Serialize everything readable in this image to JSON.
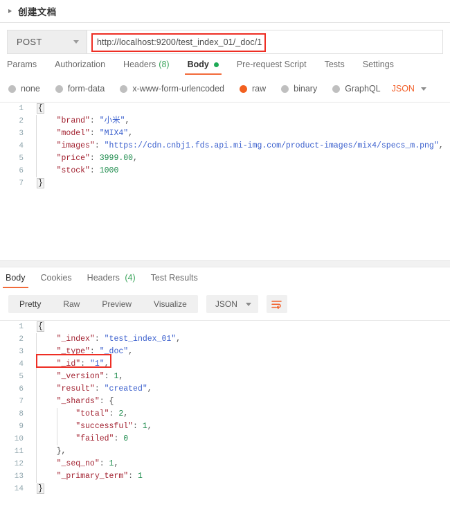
{
  "doc_heading": {
    "title": "创建文档",
    "expander_icon": "triangle-right-icon"
  },
  "url_bar": {
    "method": "POST",
    "method_caret_icon": "chevron-down-icon",
    "url": "http://localhost:9200/test_index_01/_doc/1",
    "highlight_color": "#ee2e24"
  },
  "request_tabs": [
    {
      "label": "Params",
      "active": false
    },
    {
      "label": "Authorization",
      "active": false
    },
    {
      "label": "Headers",
      "count": "(8)",
      "active": false
    },
    {
      "label": "Body",
      "active": true,
      "dot": true
    },
    {
      "label": "Pre-request Script",
      "active": false
    },
    {
      "label": "Tests",
      "active": false
    },
    {
      "label": "Settings",
      "active": false
    }
  ],
  "body_types": [
    {
      "label": "none",
      "selected": false
    },
    {
      "label": "form-data",
      "selected": false
    },
    {
      "label": "x-www-form-urlencoded",
      "selected": false
    },
    {
      "label": "raw",
      "selected": true
    },
    {
      "label": "binary",
      "selected": false
    },
    {
      "label": "GraphQL",
      "selected": false
    }
  ],
  "body_format": {
    "value": "JSON",
    "caret_icon": "chevron-down-icon",
    "color": "#f2602a"
  },
  "request_body_lines": [
    {
      "n": "1",
      "segments": [
        {
          "t": "{",
          "c": "brace-box"
        }
      ]
    },
    {
      "n": "2",
      "segments": [
        {
          "t": "    ",
          "c": "punc"
        },
        {
          "t": "\"brand\"",
          "c": "key"
        },
        {
          "t": ": ",
          "c": "punc"
        },
        {
          "t": "\"小米\"",
          "c": "str"
        },
        {
          "t": ",",
          "c": "punc"
        }
      ]
    },
    {
      "n": "3",
      "segments": [
        {
          "t": "    ",
          "c": "punc"
        },
        {
          "t": "\"model\"",
          "c": "key"
        },
        {
          "t": ": ",
          "c": "punc"
        },
        {
          "t": "\"MIX4\"",
          "c": "str"
        },
        {
          "t": ",",
          "c": "punc"
        }
      ]
    },
    {
      "n": "4",
      "segments": [
        {
          "t": "    ",
          "c": "punc"
        },
        {
          "t": "\"images\"",
          "c": "key"
        },
        {
          "t": ": ",
          "c": "punc"
        },
        {
          "t": "\"https://cdn.cnbj1.fds.api.mi-img.com/product-images/mix4/specs_m.png\"",
          "c": "str"
        },
        {
          "t": ",",
          "c": "punc"
        }
      ]
    },
    {
      "n": "5",
      "segments": [
        {
          "t": "    ",
          "c": "punc"
        },
        {
          "t": "\"price\"",
          "c": "key"
        },
        {
          "t": ": ",
          "c": "punc"
        },
        {
          "t": "3999.00",
          "c": "num"
        },
        {
          "t": ",",
          "c": "punc"
        }
      ]
    },
    {
      "n": "6",
      "segments": [
        {
          "t": "    ",
          "c": "punc"
        },
        {
          "t": "\"stock\"",
          "c": "key"
        },
        {
          "t": ": ",
          "c": "punc"
        },
        {
          "t": "1000",
          "c": "num"
        }
      ]
    },
    {
      "n": "7",
      "segments": [
        {
          "t": "}",
          "c": "brace-box"
        }
      ]
    }
  ],
  "response_tabs": [
    {
      "label": "Body",
      "active": true
    },
    {
      "label": "Cookies",
      "active": false
    },
    {
      "label": "Headers",
      "count": "(4)",
      "active": false
    },
    {
      "label": "Test Results",
      "active": false
    }
  ],
  "response_view_modes": [
    {
      "label": "Pretty",
      "active": true
    },
    {
      "label": "Raw",
      "active": false
    },
    {
      "label": "Preview",
      "active": false
    },
    {
      "label": "Visualize",
      "active": false
    }
  ],
  "response_format": {
    "value": "JSON",
    "caret_icon": "chevron-down-icon"
  },
  "wrap_button": {
    "icon": "word-wrap-icon",
    "color": "#f2602a"
  },
  "response_body_lines": [
    {
      "n": "1",
      "segments": [
        {
          "t": "{",
          "c": "brace-box"
        }
      ]
    },
    {
      "n": "2",
      "segments": [
        {
          "t": "    ",
          "c": "punc"
        },
        {
          "t": "\"_index\"",
          "c": "key"
        },
        {
          "t": ": ",
          "c": "punc"
        },
        {
          "t": "\"test_index_01\"",
          "c": "str"
        },
        {
          "t": ",",
          "c": "punc"
        }
      ]
    },
    {
      "n": "3",
      "segments": [
        {
          "t": "    ",
          "c": "punc"
        },
        {
          "t": "\"_type\"",
          "c": "key"
        },
        {
          "t": ": ",
          "c": "punc"
        },
        {
          "t": "\"_doc\"",
          "c": "str"
        },
        {
          "t": ",",
          "c": "punc"
        }
      ]
    },
    {
      "n": "4",
      "segments": [
        {
          "t": "    ",
          "c": "punc"
        },
        {
          "t": "\"_id\"",
          "c": "key"
        },
        {
          "t": ": ",
          "c": "punc"
        },
        {
          "t": "\"1\"",
          "c": "str"
        },
        {
          "t": ",",
          "c": "punc"
        }
      ]
    },
    {
      "n": "5",
      "segments": [
        {
          "t": "    ",
          "c": "punc"
        },
        {
          "t": "\"_version\"",
          "c": "key"
        },
        {
          "t": ": ",
          "c": "punc"
        },
        {
          "t": "1",
          "c": "num"
        },
        {
          "t": ",",
          "c": "punc"
        }
      ]
    },
    {
      "n": "6",
      "segments": [
        {
          "t": "    ",
          "c": "punc"
        },
        {
          "t": "\"result\"",
          "c": "key"
        },
        {
          "t": ": ",
          "c": "punc"
        },
        {
          "t": "\"created\"",
          "c": "str"
        },
        {
          "t": ",",
          "c": "punc"
        }
      ]
    },
    {
      "n": "7",
      "segments": [
        {
          "t": "    ",
          "c": "punc"
        },
        {
          "t": "\"_shards\"",
          "c": "key"
        },
        {
          "t": ": ",
          "c": "punc"
        },
        {
          "t": "{",
          "c": "brace"
        }
      ]
    },
    {
      "n": "8",
      "segments": [
        {
          "t": "        ",
          "c": "punc"
        },
        {
          "t": "\"total\"",
          "c": "key"
        },
        {
          "t": ": ",
          "c": "punc"
        },
        {
          "t": "2",
          "c": "num"
        },
        {
          "t": ",",
          "c": "punc"
        }
      ]
    },
    {
      "n": "9",
      "segments": [
        {
          "t": "        ",
          "c": "punc"
        },
        {
          "t": "\"successful\"",
          "c": "key"
        },
        {
          "t": ": ",
          "c": "punc"
        },
        {
          "t": "1",
          "c": "num"
        },
        {
          "t": ",",
          "c": "punc"
        }
      ]
    },
    {
      "n": "10",
      "segments": [
        {
          "t": "        ",
          "c": "punc"
        },
        {
          "t": "\"failed\"",
          "c": "key"
        },
        {
          "t": ": ",
          "c": "punc"
        },
        {
          "t": "0",
          "c": "num"
        }
      ]
    },
    {
      "n": "11",
      "segments": [
        {
          "t": "    ",
          "c": "punc"
        },
        {
          "t": "},",
          "c": "brace"
        }
      ]
    },
    {
      "n": "12",
      "segments": [
        {
          "t": "    ",
          "c": "punc"
        },
        {
          "t": "\"_seq_no\"",
          "c": "key"
        },
        {
          "t": ": ",
          "c": "punc"
        },
        {
          "t": "1",
          "c": "num"
        },
        {
          "t": ",",
          "c": "punc"
        }
      ]
    },
    {
      "n": "13",
      "segments": [
        {
          "t": "    ",
          "c": "punc"
        },
        {
          "t": "\"_primary_term\"",
          "c": "key"
        },
        {
          "t": ": ",
          "c": "punc"
        },
        {
          "t": "1",
          "c": "num"
        }
      ]
    },
    {
      "n": "14",
      "segments": [
        {
          "t": "}",
          "c": "brace-box"
        }
      ]
    }
  ]
}
